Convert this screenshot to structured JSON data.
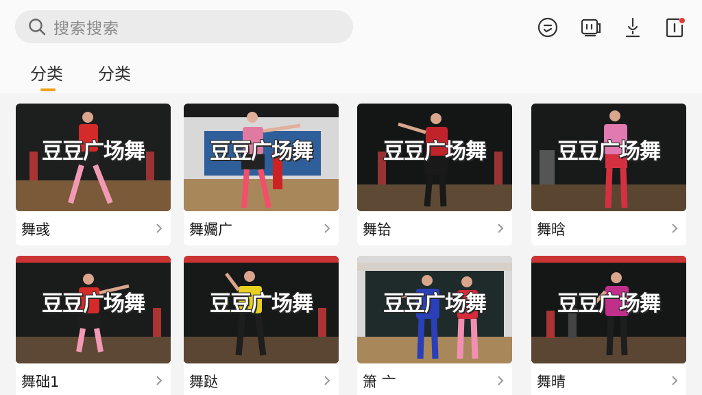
{
  "search": {
    "placeholder_text": "搜索搜索",
    "icon": "search-icon"
  },
  "toolbar": {
    "icons": [
      "emoji-face-icon",
      "tv-cast-icon",
      "microphone-icon",
      "notification-icon"
    ],
    "notification_dot_color": "#e53935"
  },
  "tabs": [
    {
      "label": "分类",
      "active": true
    },
    {
      "label": "分类",
      "active": false
    }
  ],
  "accent_color": "#f0a020",
  "videos": [
    {
      "overlay": "豆豆广场舞",
      "title": "舞彧"
    },
    {
      "overlay": "豆豆广场舞",
      "title": "舞孎广"
    },
    {
      "overlay": "豆豆广场舞",
      "title": "舞铪"
    },
    {
      "overlay": "豆豆广场舞",
      "title": "舞晗"
    },
    {
      "overlay": "豆豆广场舞",
      "title": "舞础1"
    },
    {
      "overlay": "豆豆广场舞",
      "title": "舞跶"
    },
    {
      "overlay": "豆豆广场舞",
      "title": "箫 亠"
    },
    {
      "overlay": "豆豆广场舞",
      "title": "舞晴"
    }
  ]
}
